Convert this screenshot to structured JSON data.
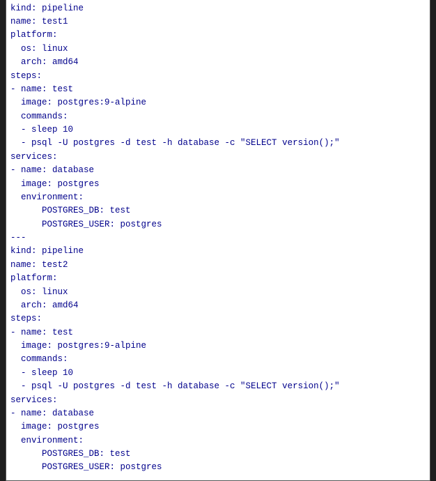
{
  "code": {
    "lines": [
      "---",
      "kind: pipeline",
      "name: test1",
      "platform:",
      "  os: linux",
      "  arch: amd64",
      "steps:",
      "- name: test",
      "  image: postgres:9-alpine",
      "  commands:",
      "  - sleep 10",
      "  - psql -U postgres -d test -h database -c \"SELECT version();\"",
      "services:",
      "- name: database",
      "  image: postgres",
      "  environment:",
      "      POSTGRES_DB: test",
      "      POSTGRES_USER: postgres",
      "---",
      "kind: pipeline",
      "name: test2",
      "platform:",
      "  os: linux",
      "  arch: amd64",
      "steps:",
      "- name: test",
      "  image: postgres:9-alpine",
      "  commands:",
      "  - sleep 10",
      "  - psql -U postgres -d test -h database -c \"SELECT version();\"",
      "services:",
      "- name: database",
      "  image: postgres",
      "  environment:",
      "      POSTGRES_DB: test",
      "      POSTGRES_USER: postgres"
    ]
  }
}
